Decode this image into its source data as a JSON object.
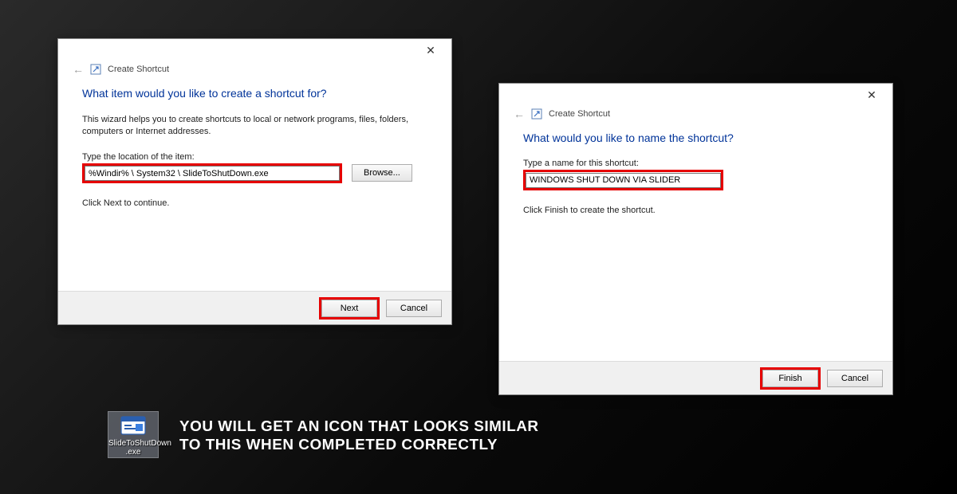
{
  "dialog1": {
    "crumb": "Create Shortcut",
    "heading": "What item would you like to create a shortcut for?",
    "help": "This wizard helps you to create shortcuts to local or network programs, files, folders, computers or Internet addresses.",
    "loc_label": "Type the location of the item:",
    "loc_value": "%Windir% \\ System32 \\ SlideToShutDown.exe",
    "browse": "Browse...",
    "continue_hint": "Click Next to continue.",
    "next": "Next",
    "cancel": "Cancel"
  },
  "dialog2": {
    "crumb": "Create Shortcut",
    "heading": "What would you like to name the shortcut?",
    "name_label": "Type a name for this shortcut:",
    "name_value": "WINDOWS SHUT DOWN VIA SLIDER",
    "finish_hint": "Click Finish to create the shortcut.",
    "finish": "Finish",
    "cancel": "Cancel"
  },
  "shortcut": {
    "label_line1": "SlideToShutDown",
    "label_line2": ".exe"
  },
  "caption_line1": "You will get an icon that looks similar",
  "caption_line2": "to this when completed correctly"
}
